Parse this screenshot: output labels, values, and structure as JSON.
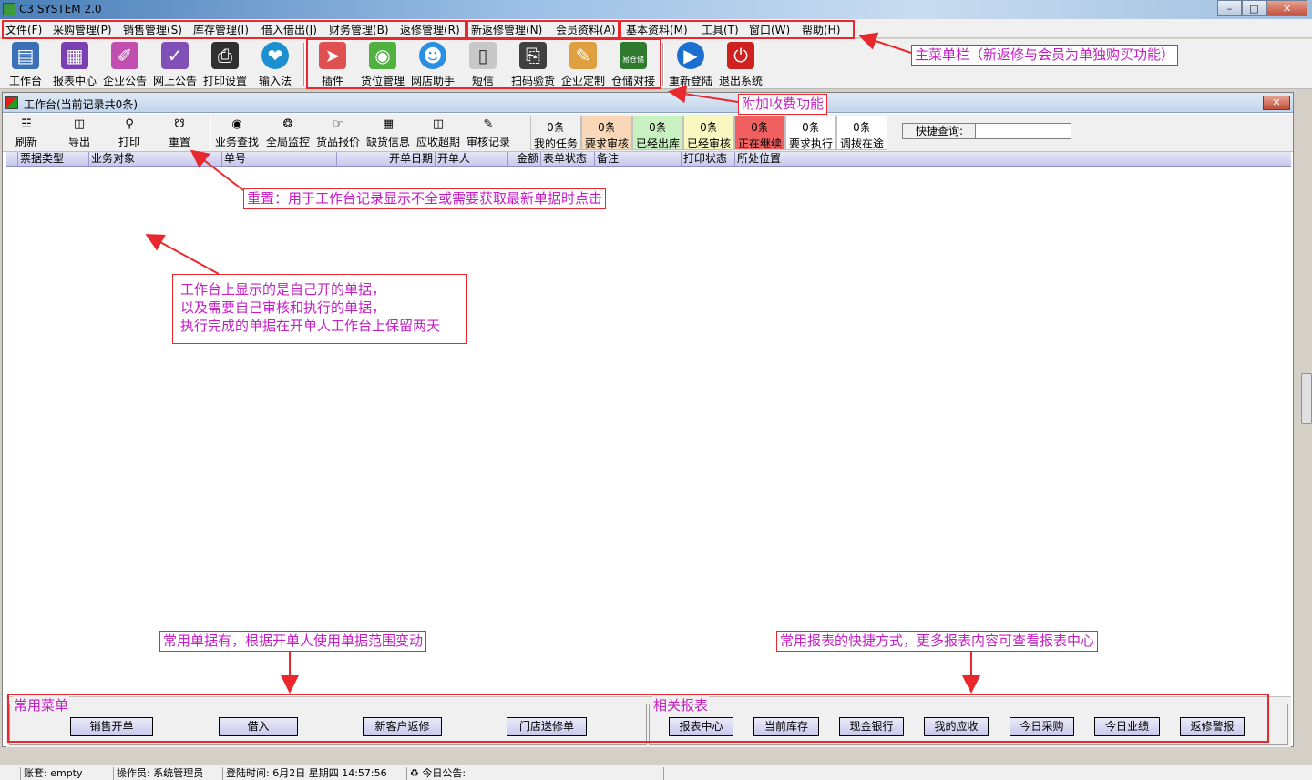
{
  "window": {
    "title": "C3 SYSTEM 2.0"
  },
  "menus": [
    "文件(F)",
    "采购管理(P)",
    "销售管理(S)",
    "库存管理(I)",
    "借入借出(J)",
    "财务管理(B)",
    "返修管理(R)",
    "新返修管理(N)",
    "会员资料(A)",
    "基本资料(M)",
    "工具(T)",
    "窗口(W)",
    "帮助(H)"
  ],
  "toolbar": [
    "工作台",
    "报表中心",
    "企业公告",
    "网上公告",
    "打印设置",
    "输入法",
    "插件",
    "货位管理",
    "网店助手",
    "短信",
    "扫码验货",
    "企业定制",
    "仓储对接",
    "重新登陆",
    "退出系统"
  ],
  "toolbar_icon_names": [
    "monitor-icon",
    "report-icon",
    "notice-icon",
    "web-notice-icon",
    "printer-icon",
    "input-method-icon",
    "plugin-icon",
    "location-icon",
    "shop-assistant-icon",
    "sms-icon",
    "scanner-icon",
    "custom-icon",
    "warehouse-icon",
    "relogin-icon",
    "exit-icon"
  ],
  "warehouse_badge": "易仓储",
  "workbench": {
    "title": "工作台(当前记录共0条)",
    "buttons": [
      "刷新",
      "导出",
      "打印",
      "重置",
      "业务查找",
      "全局监控",
      "货品报价",
      "缺货信息",
      "应收超期",
      "审核记录"
    ],
    "counters": [
      {
        "count": "0条",
        "label": "我的任务",
        "color": "#f0f0f0"
      },
      {
        "count": "0条",
        "label": "要求审核",
        "color": "#f8d8b8"
      },
      {
        "count": "0条",
        "label": "已经出库",
        "color": "#c8f0c0"
      },
      {
        "count": "0条",
        "label": "已经审核",
        "color": "#f8f8c0"
      },
      {
        "count": "0条",
        "label": "正在继续",
        "color": "#f06060"
      },
      {
        "count": "0条",
        "label": "要求执行",
        "color": "#ffffff"
      },
      {
        "count": "0条",
        "label": "调拨在途",
        "color": "#ffffff"
      }
    ],
    "quick_search_label": "快捷查询:",
    "quick_search_value": "",
    "columns": [
      "票据类型",
      "业务对象",
      "单号",
      "开单日期",
      "开单人",
      "金额",
      "表单状态",
      "备注",
      "打印状态",
      "所处位置"
    ]
  },
  "common_menu": {
    "title": "常用菜单",
    "buttons": [
      "销售开单",
      "借入",
      "新客户返修",
      "门店送修单"
    ]
  },
  "related_reports": {
    "title": "相关报表",
    "buttons": [
      "报表中心",
      "当前库存",
      "现金银行",
      "我的应收",
      "今日采购",
      "今日业绩",
      "返修警报"
    ]
  },
  "annotations": {
    "main_menu": "主菜单栏（新返修与会员为单独购买功能）",
    "paid_features": "附加收费功能",
    "reset": "重置：用于工作台记录显示不全或需要获取最新单据时点击",
    "workbench_lines": [
      "工作台上显示的是自己开的单据，",
      "以及需要自己审核和执行的单据，",
      "执行完成的单据在开单人工作台上保留两天"
    ],
    "common_docs": "常用单据有，根据开单人使用单据范围变动",
    "common_reports": "常用报表的快捷方式，更多报表内容可查看报表中心"
  },
  "status": {
    "account_label": "账套:",
    "account": "empty",
    "operator_label": "操作员:",
    "operator": "系统管理员",
    "login_label": "登陆时间:",
    "login_time": "6月2日 星期四 14:57:56",
    "notice_label": "今日公告:"
  }
}
